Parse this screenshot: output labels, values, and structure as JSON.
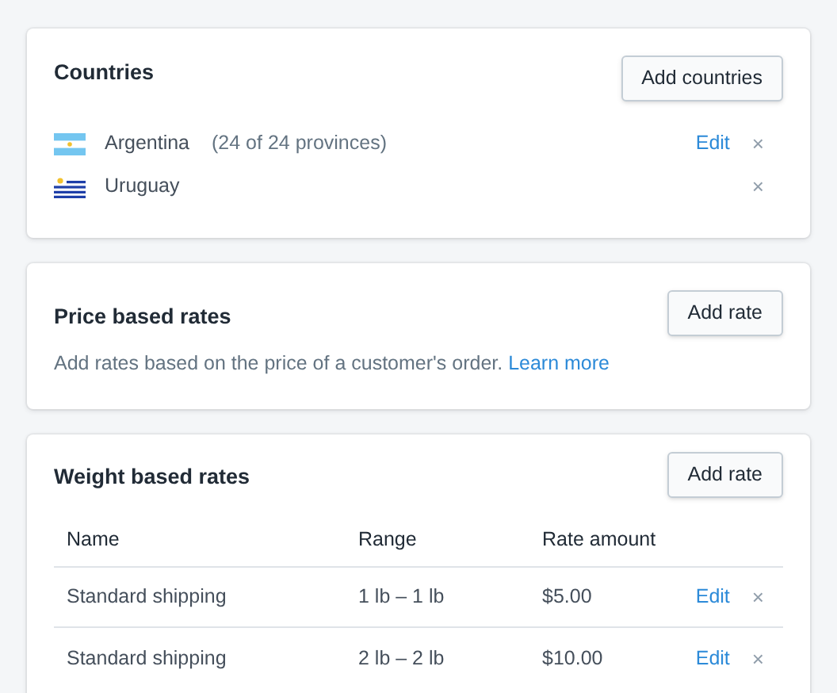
{
  "countries": {
    "title": "Countries",
    "button": "Add countries",
    "items": [
      {
        "kind": "argentina",
        "name": "Argentina",
        "detail": "(24 of 24 provinces)",
        "edit": "Edit",
        "remove": "×"
      },
      {
        "kind": "uruguay",
        "name": "Uruguay",
        "remove": "×"
      }
    ]
  },
  "price_rates": {
    "title": "Price based rates",
    "button": "Add rate",
    "text": "Add rates based on the price of a customer's order.",
    "link": "Learn more"
  },
  "weight_rates": {
    "title": "Weight based rates",
    "button": "Add rate",
    "columns": [
      "Name",
      "Range",
      "Rate amount"
    ],
    "rows": [
      {
        "cells": [
          "Standard shipping",
          "1 lb – 1 lb",
          "$5.00"
        ],
        "edit": "Edit",
        "remove": "×"
      },
      {
        "cells": [
          "Standard shipping",
          "2 lb – 2 lb",
          "$10.00"
        ],
        "edit": "Edit",
        "remove": "×"
      }
    ]
  }
}
